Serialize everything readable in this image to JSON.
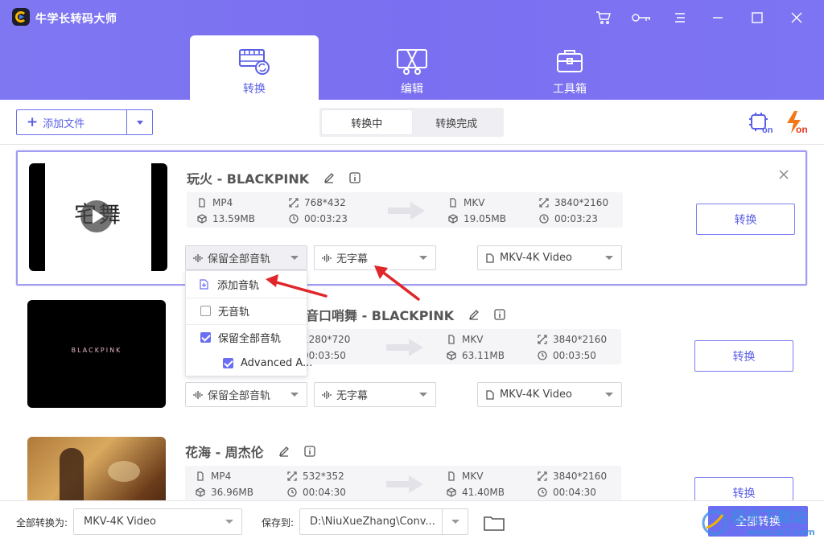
{
  "app": {
    "title": "牛学长转码大师"
  },
  "main_tabs": [
    {
      "label": "转换",
      "icon": "convert-film-icon"
    },
    {
      "label": "编辑",
      "icon": "edit-scissors-icon"
    },
    {
      "label": "工具箱",
      "icon": "toolbox-icon"
    }
  ],
  "toolbar": {
    "add_file_label": "添加文件",
    "status_tabs": [
      "转换中",
      "转换完成"
    ],
    "icons": [
      "hardware-acceleration-icon",
      "high-speed-on-icon"
    ]
  },
  "files": [
    {
      "title": "玩火 - BLACKPINK",
      "thumb_text": "宅舞",
      "src": {
        "format": "MP4",
        "resolution": "768*432",
        "size": "13.59MB",
        "duration": "00:03:23"
      },
      "dst": {
        "format": "MKV",
        "resolution": "3840*2160",
        "size": "19.05MB",
        "duration": "00:03:23"
      },
      "audio": "保留全部音轨",
      "subtitle": "无字幕",
      "output": "MKV-4K Video",
      "convert_label": "转换"
    },
    {
      "title": "音口哨舞 - BLACKPINK",
      "thumb_text": "BLACKPINK",
      "src": {
        "format": "",
        "resolution": "1280*720",
        "size": "",
        "duration": "00:03:50"
      },
      "dst": {
        "format": "MKV",
        "resolution": "3840*2160",
        "size": "63.11MB",
        "duration": "00:03:50"
      },
      "audio": "保留全部音轨",
      "subtitle": "无字幕",
      "output": "MKV-4K Video",
      "convert_label": "转换"
    },
    {
      "title": "花海 - 周杰伦",
      "thumb_text": "",
      "src": {
        "format": "MP4",
        "resolution": "532*352",
        "size": "36.96MB",
        "duration": "00:04:30"
      },
      "dst": {
        "format": "MKV",
        "resolution": "3840*2160",
        "size": "41.40MB",
        "duration": "00:04:30"
      },
      "audio": "",
      "subtitle": "",
      "output": "",
      "convert_label": "转换"
    }
  ],
  "audio_menu": {
    "items": [
      {
        "label": "添加音轨",
        "type": "add",
        "checked": false
      },
      {
        "label": "无音轨",
        "type": "checkbox",
        "checked": false
      },
      {
        "label": "保留全部音轨",
        "type": "checkbox",
        "checked": true
      },
      {
        "label": "Advanced A...",
        "type": "checkbox",
        "checked": true
      }
    ]
  },
  "bottom": {
    "convert_all_to_label": "全部转换为:",
    "convert_all_to_value": "MKV-4K Video",
    "save_to_label": "保存到:",
    "save_to_value": "D:\\NiuXueZhang\\Conv...",
    "convert_all_label": "全部转换"
  },
  "watermark": {
    "text": "极光下载站",
    "url": "www.xz7.com"
  },
  "colors": {
    "accent": "#6a6ef0",
    "header": "#7c73f2",
    "annotation": "#e0262b"
  }
}
